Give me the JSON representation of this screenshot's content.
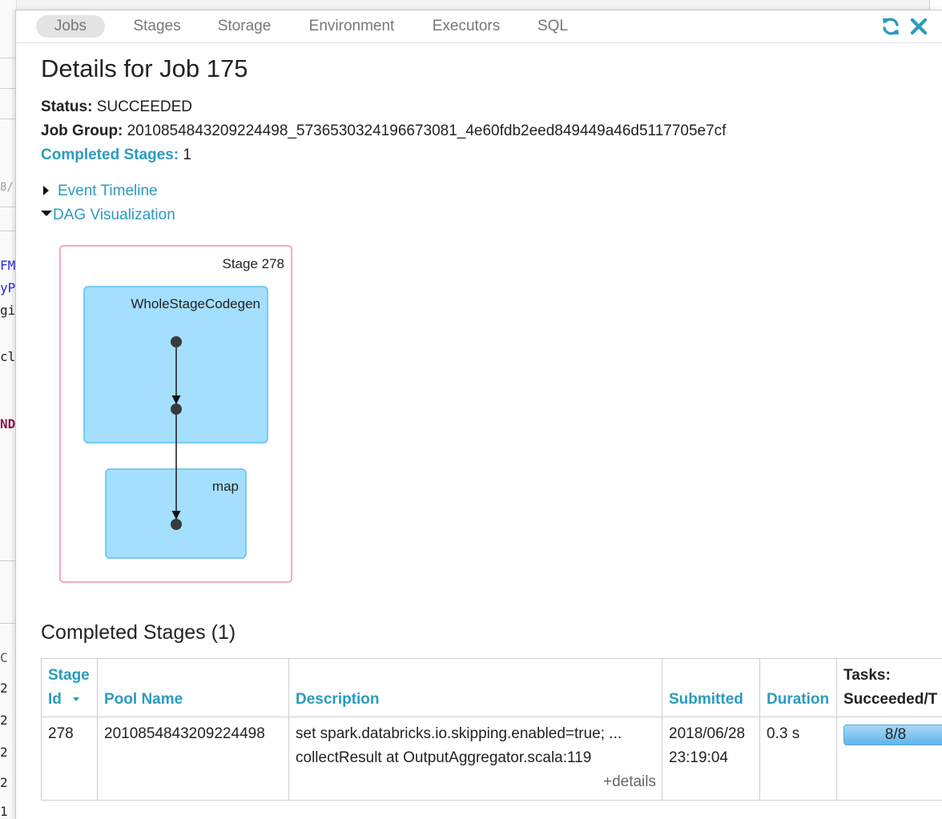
{
  "background": {
    "fragments": [
      "8/",
      "FMe",
      "yP",
      "gi",
      "cl",
      "ND",
      "C",
      "2",
      "2",
      "2",
      "2",
      "1"
    ]
  },
  "nav": {
    "tabs": [
      {
        "label": "Jobs",
        "active": true
      },
      {
        "label": "Stages",
        "active": false
      },
      {
        "label": "Storage",
        "active": false
      },
      {
        "label": "Environment",
        "active": false
      },
      {
        "label": "Executors",
        "active": false
      },
      {
        "label": "SQL",
        "active": false
      }
    ],
    "icons": [
      "refresh-icon",
      "close-icon"
    ],
    "accent": "#2a9bbe"
  },
  "page": {
    "title": "Details for Job 175",
    "status_label": "Status:",
    "status_value": "SUCCEEDED",
    "job_group_label": "Job Group:",
    "job_group_value": "2010854843209224498_5736530324196673081_4e60fdb2eed849449a46d5117705e7cf",
    "completed_stages_label": "Completed Stages:",
    "completed_stages_value": "1",
    "event_timeline": "Event Timeline",
    "dag_visualization": "DAG Visualization"
  },
  "dag": {
    "stage_label": "Stage 278",
    "cluster_top": "WholeStageCodegen",
    "cluster_bottom": "map",
    "stage_border_color": "#f28ea0",
    "cluster_fill": "#a4dffd",
    "cluster_border": "#5cc1ee"
  },
  "stages": {
    "heading": "Completed Stages (1)",
    "headers": {
      "stage_id_1": "Stage",
      "stage_id_2": "Id",
      "pool_name": "Pool Name",
      "description": "Description",
      "submitted": "Submitted",
      "duration": "Duration",
      "tasks_1": "Tasks:",
      "tasks_2": "Succeeded/T"
    },
    "rows": [
      {
        "stage_id": "278",
        "pool_name": "2010854843209224498",
        "description": "set spark.databricks.io.skipping.enabled=true; ...",
        "description_link": "collectResult at OutputAggregator.scala:119",
        "details": "+details",
        "submitted_date": "2018/06/28",
        "submitted_time": "23:19:04",
        "duration": "0.3 s",
        "tasks": "8/8",
        "tasks_fraction": 1.0
      }
    ]
  }
}
